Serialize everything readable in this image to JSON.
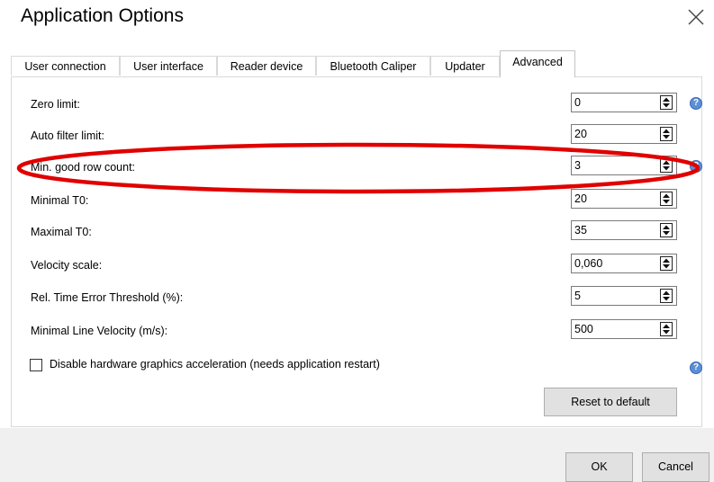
{
  "window": {
    "title": "Application Options"
  },
  "tabs": [
    {
      "label": "User connection"
    },
    {
      "label": "User interface"
    },
    {
      "label": "Reader device"
    },
    {
      "label": "Bluetooth Caliper"
    },
    {
      "label": "Updater"
    },
    {
      "label": "Advanced"
    }
  ],
  "active_tab": "Advanced",
  "fields": [
    {
      "label": "Zero limit:",
      "value": "0"
    },
    {
      "label": "Auto filter limit:",
      "value": "20"
    },
    {
      "label": "Min. good row count:",
      "value": "3"
    },
    {
      "label": "Minimal T0:",
      "value": "20"
    },
    {
      "label": "Maximal T0:",
      "value": "35"
    },
    {
      "label": "Velocity scale:",
      "value": "0,060"
    },
    {
      "label": "Rel. Time Error Threshold (%):",
      "value": "5"
    },
    {
      "label": "Minimal Line Velocity (m/s):",
      "value": "500"
    }
  ],
  "checkbox": {
    "label": "Disable hardware graphics acceleration (needs application restart)",
    "checked": false
  },
  "buttons": {
    "reset": "Reset to default",
    "ok": "OK",
    "cancel": "Cancel"
  },
  "help_glyph": "?",
  "icons": {
    "close": "close-icon",
    "help": "help-icon",
    "spin": "spin-arrows-icon"
  },
  "colors": {
    "annotation": "#e00000",
    "help": "#5b8fd6"
  }
}
